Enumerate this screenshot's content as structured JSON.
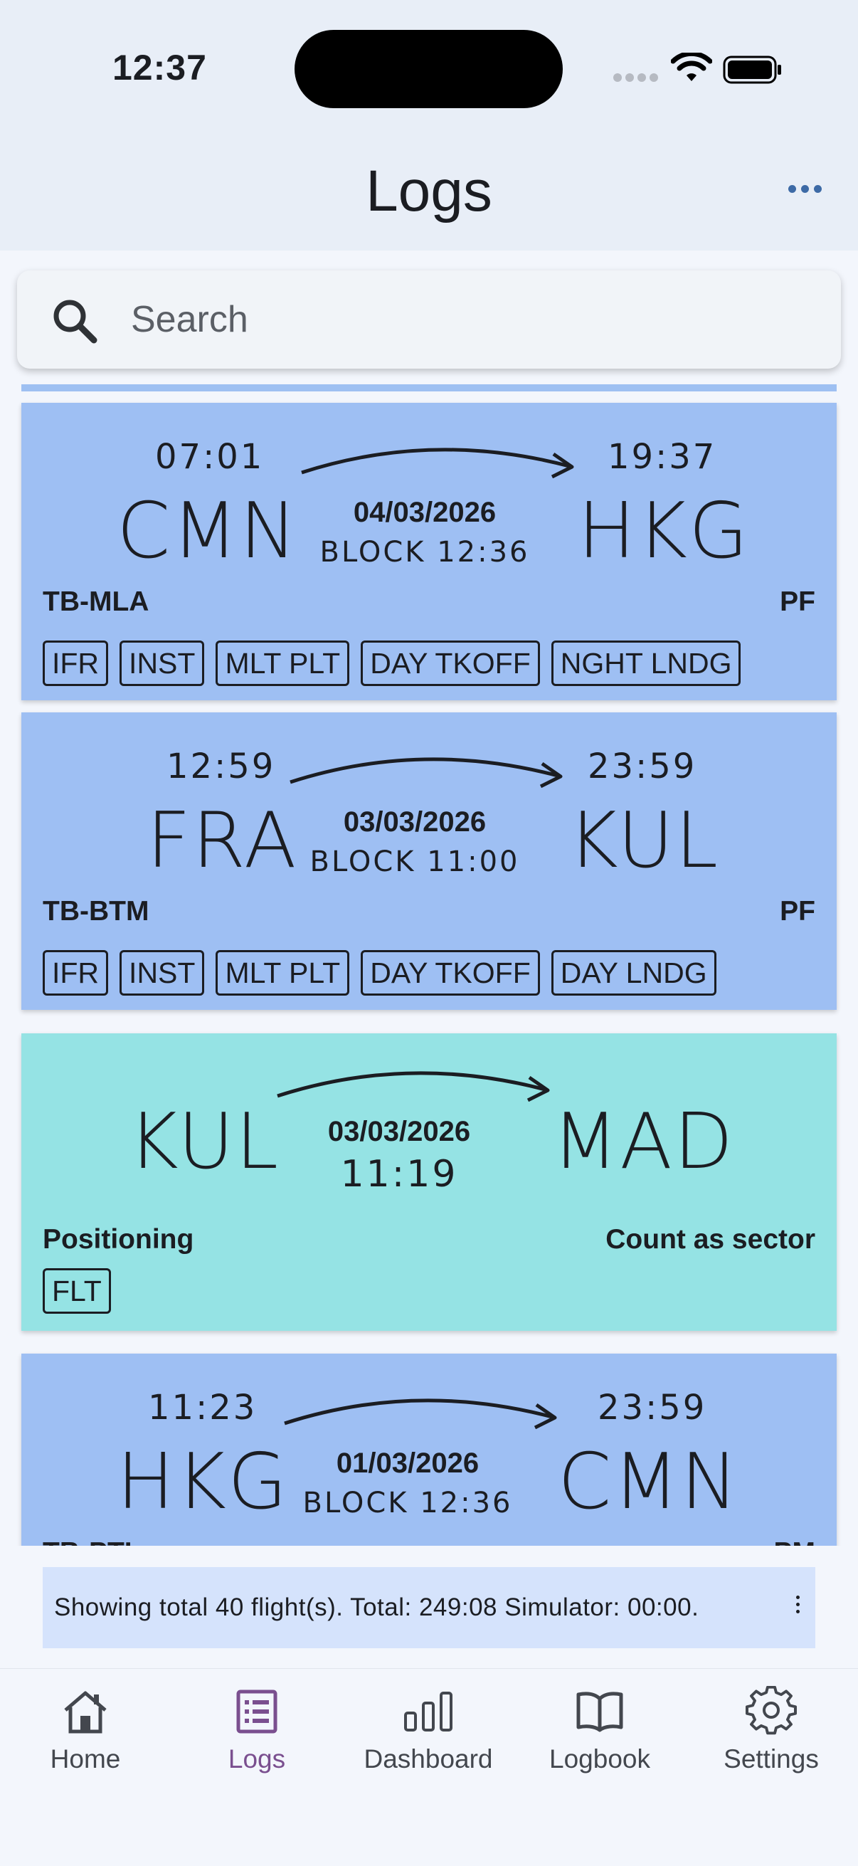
{
  "status_bar": {
    "time": "12:37"
  },
  "header": {
    "title": "Logs",
    "more_icon": "more-horizontal-icon"
  },
  "search": {
    "placeholder": "Search",
    "value": ""
  },
  "flights": [
    {
      "type": "flight",
      "color": "#9ebff3",
      "dep_time": "07:01",
      "arr_time": "19:37",
      "from": "CMN",
      "to": "HKG",
      "date": "04/03/2026",
      "block": "BLOCK 12:36",
      "registration": "TB-MLA",
      "role": "PF",
      "tags": [
        "IFR",
        "INST",
        "MLT PLT",
        "DAY TKOFF",
        "NGHT LNDG"
      ]
    },
    {
      "type": "flight",
      "color": "#9ebff3",
      "dep_time": "12:59",
      "arr_time": "23:59",
      "from": "FRA",
      "to": "KUL",
      "date": "03/03/2026",
      "block": "BLOCK 11:00",
      "registration": "TB-BTM",
      "role": "PF",
      "tags": [
        "IFR",
        "INST",
        "MLT PLT",
        "DAY TKOFF",
        "DAY LNDG"
      ]
    },
    {
      "type": "positioning",
      "color": "#95e3e4",
      "from": "KUL",
      "to": "MAD",
      "date": "03/03/2026",
      "duration": "11:19",
      "label_left": "Positioning",
      "label_right": "Count as sector",
      "tags": [
        "FLT"
      ]
    },
    {
      "type": "flight",
      "color": "#9ebff3",
      "dep_time": "11:23",
      "arr_time": "23:59",
      "from": "HKG",
      "to": "CMN",
      "date": "01/03/2026",
      "block": "BLOCK 12:36",
      "registration": "TB-PTL",
      "role": "PM"
    }
  ],
  "summary": {
    "text": "Showing total 40 flight(s). Total: 249:08 Simulator: 00:00."
  },
  "tabbar": {
    "items": [
      {
        "label": "Home",
        "icon": "home-icon"
      },
      {
        "label": "Logs",
        "icon": "list-icon",
        "active": true
      },
      {
        "label": "Dashboard",
        "icon": "bar-chart-icon"
      },
      {
        "label": "Logbook",
        "icon": "book-icon"
      },
      {
        "label": "Settings",
        "icon": "gear-icon"
      }
    ]
  }
}
